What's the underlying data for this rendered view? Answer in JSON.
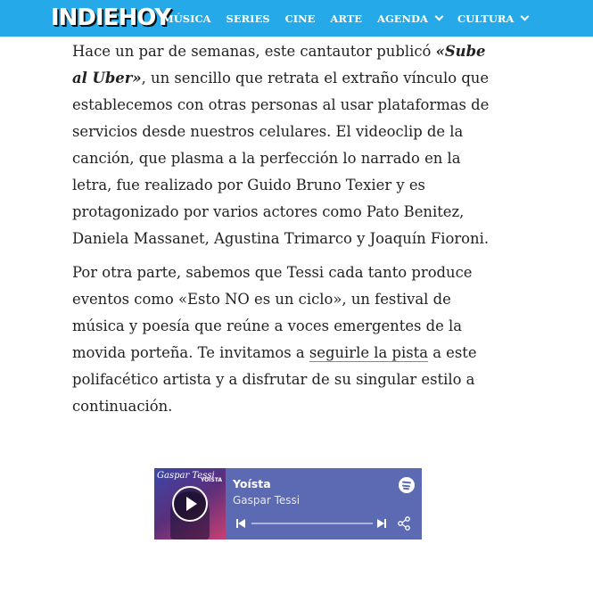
{
  "header": {
    "logo": "INDIEHOY",
    "nav": [
      {
        "label": "MÚSICA"
      },
      {
        "label": "SERIES"
      },
      {
        "label": "CINE"
      },
      {
        "label": "ARTE"
      },
      {
        "label": "AGENDA"
      },
      {
        "label": "CULTURA"
      }
    ]
  },
  "article": {
    "p1": {
      "a": "Hace un par de semanas, este cantautor publicó ",
      "emph": "«Sube al Uber»",
      "b": ", un sencillo que retrata el extraño vínculo que establecemos con otras personas al usar plataformas de servicios desde nuestros celulares. El videoclip de la canción, que plasma a la perfección lo narrado en la letra, fue realizado por Guido Bruno Texier y es protagonizado por varios actores como Pato Benitez, Daniela Massanet, Agustina Trimarco y Joaquín Fioroni."
    },
    "p2": {
      "a": "Por otra parte, sabemos que Tessi cada tanto produce eventos como «Esto NO es un ciclo», un festival de música y poesía que reúne a voces emergentes de la movida porteña. Te invitamos a ",
      "link": "seguirle la pista",
      "b": " a este polifacético artista y a disfrutar de su singular estilo a continuación."
    }
  },
  "player": {
    "track": "Yoísta",
    "artist": "Gaspar Tessi",
    "cover_script": "Gaspar Tessi",
    "cover_title": "YOÍSTA",
    "progress": 0,
    "colors": {
      "background": "#5b6ab2",
      "accent": "#25a9e8"
    }
  }
}
